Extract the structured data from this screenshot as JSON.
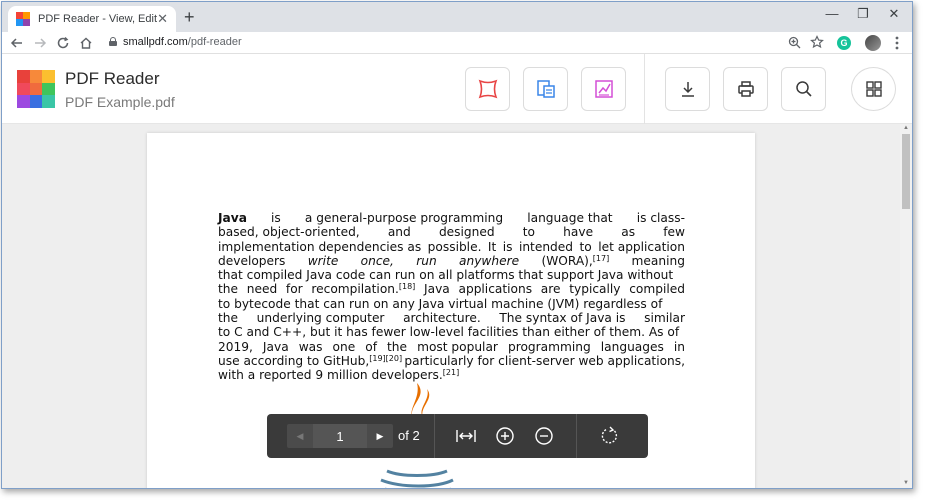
{
  "browser": {
    "tab_title": "PDF Reader - View, Edit, and Convert PDF",
    "tab_close": "✕",
    "new_tab": "+",
    "minimize": "—",
    "restore": "❐",
    "close": "✕",
    "url_host": "smallpdf.com",
    "url_path": "/pdf-reader",
    "grammarly_letter": "G",
    "icons": [
      "back-arrow",
      "forward-arrow",
      "reload",
      "home",
      "lock",
      "zoom",
      "star",
      "grammarly",
      "profile",
      "kebab-menu"
    ]
  },
  "app": {
    "title": "PDF Reader",
    "file_name": "PDF Example.pdf",
    "logo_colors": [
      "#e8413b",
      "#f7893a",
      "#fbbf2f",
      "#f0495b",
      "#f06b3d",
      "#3fc55c",
      "#9c49e0",
      "#3a6fe0",
      "#3ac6a6"
    ],
    "header_icons": [
      "annotate-icon",
      "compress-icon",
      "edit-icon",
      "download-icon",
      "print-icon",
      "search-icon",
      "apps-grid-icon"
    ],
    "colors": {
      "annotate": "#e84545",
      "compress": "#3a86e8",
      "edit": "#d44fd6",
      "neutral": "#3a3a3a"
    }
  },
  "document": {
    "lines": [
      [
        {
          "t": "Java",
          "b": true
        },
        {
          "t": "is"
        },
        {
          "t": "a general-purpose programming"
        },
        {
          "t": "language that"
        },
        {
          "t": "is class-"
        }
      ],
      [
        {
          "t": "based, object-oriented,"
        },
        {
          "t": "and"
        },
        {
          "t": "designed"
        },
        {
          "t": "to"
        },
        {
          "t": "have"
        },
        {
          "t": "as"
        },
        {
          "t": "few"
        }
      ],
      [
        {
          "t": "implementation dependencies as"
        },
        {
          "t": "possible."
        },
        {
          "t": "It"
        },
        {
          "t": "is"
        },
        {
          "t": "intended"
        },
        {
          "t": "to"
        },
        {
          "t": "let application"
        }
      ],
      [
        {
          "t": "developers"
        },
        {
          "t": "write",
          "i": true
        },
        {
          "t": "once,",
          "i": true
        },
        {
          "t": "run",
          "i": true
        },
        {
          "t": "anywhere",
          "i": true
        },
        {
          "t": "(WORA),",
          "sup": "[17]"
        },
        {
          "t": "meaning"
        }
      ],
      [
        {
          "t": "that compiled Java code can run on all platforms that support Java without"
        }
      ],
      [
        {
          "t": "the"
        },
        {
          "t": "need"
        },
        {
          "t": "for"
        },
        {
          "t": "recompilation.",
          "sup": "[18]"
        },
        {
          "t": "Java"
        },
        {
          "t": "applications"
        },
        {
          "t": "are"
        },
        {
          "t": "typically"
        },
        {
          "t": "compiled"
        }
      ],
      [
        {
          "t": "to bytecode that can run on any Java virtual machine (JVM) regardless of"
        }
      ],
      [
        {
          "t": "the"
        },
        {
          "t": "underlying computer"
        },
        {
          "t": "architecture."
        },
        {
          "t": "The syntax of Java is"
        },
        {
          "t": "similar"
        }
      ],
      [
        {
          "t": "to C and C++, but it has fewer low-level facilities than either of them. As of"
        }
      ],
      [
        {
          "t": "2019,"
        },
        {
          "t": "Java"
        },
        {
          "t": "was"
        },
        {
          "t": "one"
        },
        {
          "t": "of"
        },
        {
          "t": "the"
        },
        {
          "t": "most popular"
        },
        {
          "t": "programming"
        },
        {
          "t": "languages"
        },
        {
          "t": "in"
        }
      ],
      [
        {
          "t": "use according to GitHub,",
          "sup": "[19][20]"
        },
        {
          "t": "particularly for client-server web applications,"
        }
      ],
      [
        {
          "t": "with a reported 9 million developers.",
          "sup": "[21]"
        }
      ]
    ]
  },
  "viewer": {
    "current_page": "1",
    "of_total": "of 2",
    "prev": "◀",
    "next": "▶",
    "controls": [
      "fit-width-icon",
      "zoom-in-icon",
      "zoom-out-icon",
      "rotate-icon"
    ]
  }
}
